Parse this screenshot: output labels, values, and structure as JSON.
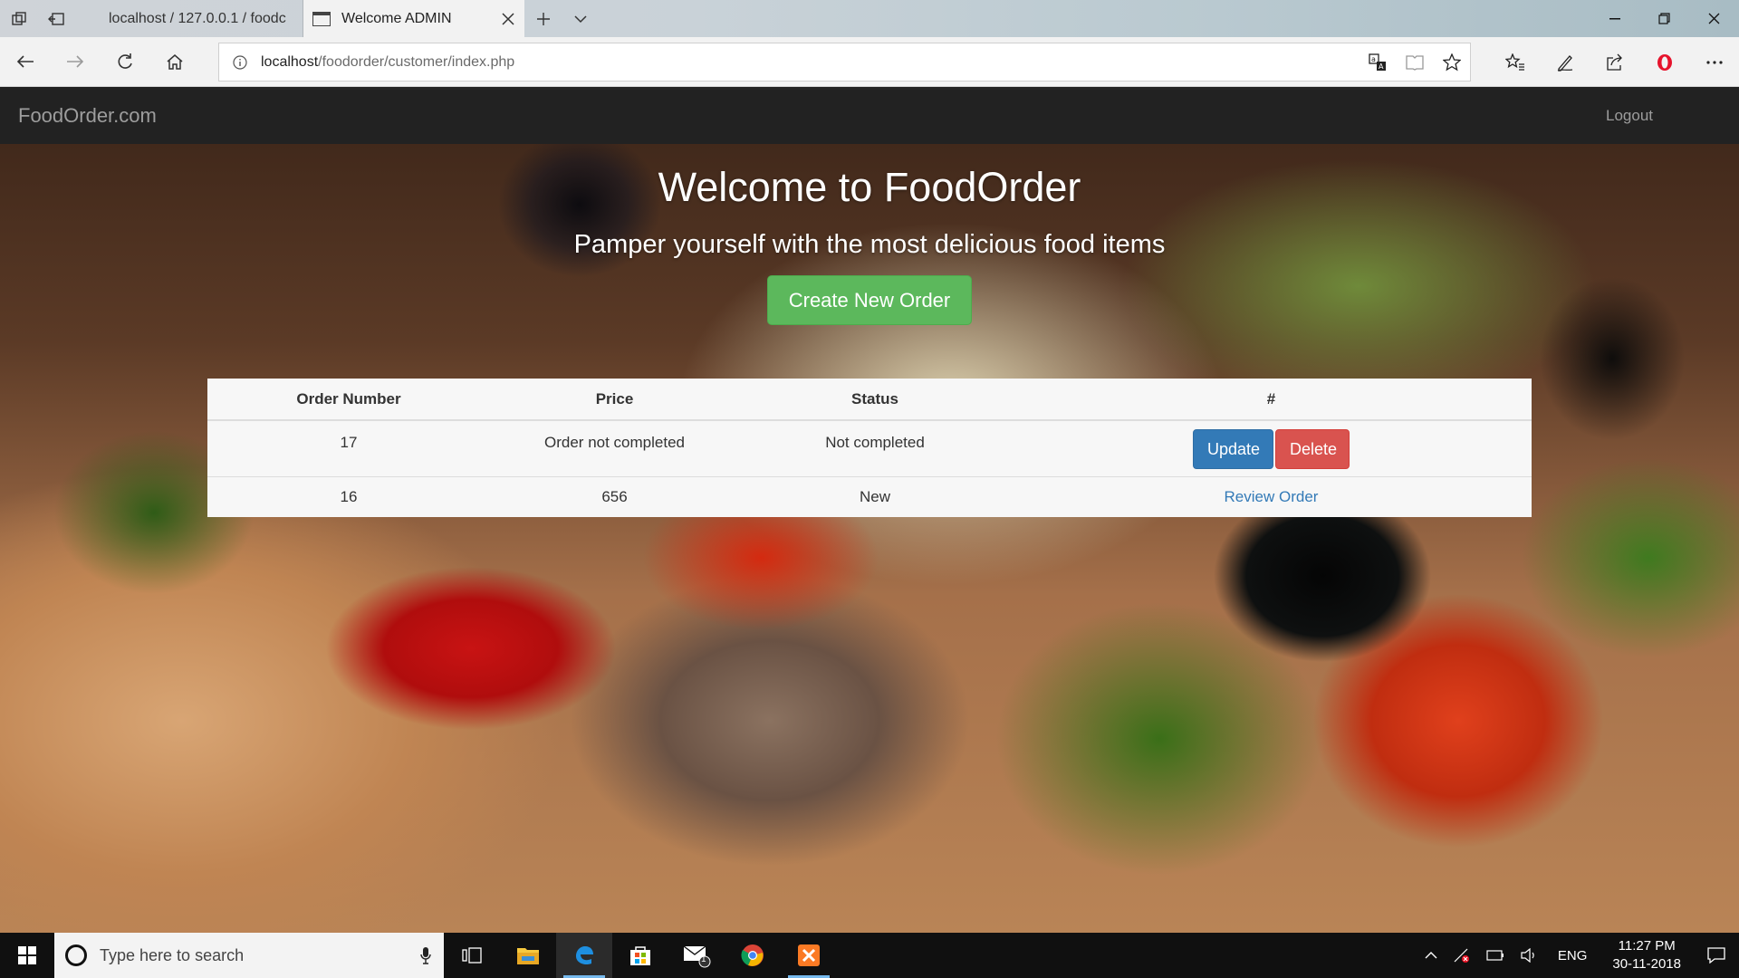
{
  "browser": {
    "tabs": [
      {
        "label": "localhost / 127.0.0.1 / foodc",
        "active": false
      },
      {
        "label": "Welcome ADMIN",
        "active": true
      }
    ],
    "address": {
      "host": "localhost",
      "path": "/foodorder/customer/index.php"
    }
  },
  "navbar": {
    "brand": "FoodOrder.com",
    "logout": "Logout"
  },
  "hero": {
    "title": "Welcome to FoodOrder",
    "subtitle": "Pamper yourself with the most delicious food items",
    "create_button": "Create New Order"
  },
  "orders": {
    "headers": [
      "Order Number",
      "Price",
      "Status",
      "#"
    ],
    "rows": [
      {
        "order_number": "17",
        "price": "Order not completed",
        "status": "Not completed",
        "update_label": "Update",
        "delete_label": "Delete"
      },
      {
        "order_number": "16",
        "price": "656",
        "status": "New",
        "review_label": "Review Order"
      }
    ]
  },
  "taskbar": {
    "search_placeholder": "Type here to search",
    "language": "ENG",
    "time": "11:27 PM",
    "date": "30-11-2018",
    "mail_badge": "1"
  },
  "colors": {
    "navbar": "#222222",
    "success": "#5cb85c",
    "primary": "#337ab7",
    "danger": "#d9534f",
    "taskbar": "#101010"
  }
}
